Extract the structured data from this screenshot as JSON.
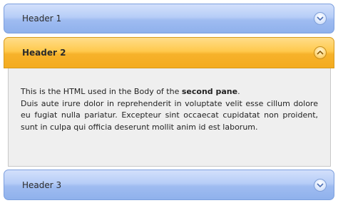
{
  "accordion": {
    "panes": [
      {
        "header": "Header 1",
        "state": "collapsed",
        "toggle_icon": "chevron-down-icon"
      },
      {
        "header": "Header 2",
        "state": "expanded",
        "toggle_icon": "chevron-up-icon"
      },
      {
        "header": "Header 3",
        "state": "collapsed",
        "toggle_icon": "chevron-down-icon"
      }
    ],
    "content": {
      "intro_prefix": "This is the HTML used in the Body of the ",
      "intro_bold": "second pane",
      "intro_suffix": ".",
      "body": "Duis aute irure dolor in reprehenderit in voluptate velit esse cillum dolore eu fugiat nulla pariatur. Excepteur sint occaecat cupidatat non proident, sunt in culpa qui officia deserunt mollit anim id est laborum."
    }
  },
  "colors": {
    "collapsed_header": "#a9c4f4",
    "expanded_header": "#f8b935",
    "content_background": "#efefef"
  }
}
